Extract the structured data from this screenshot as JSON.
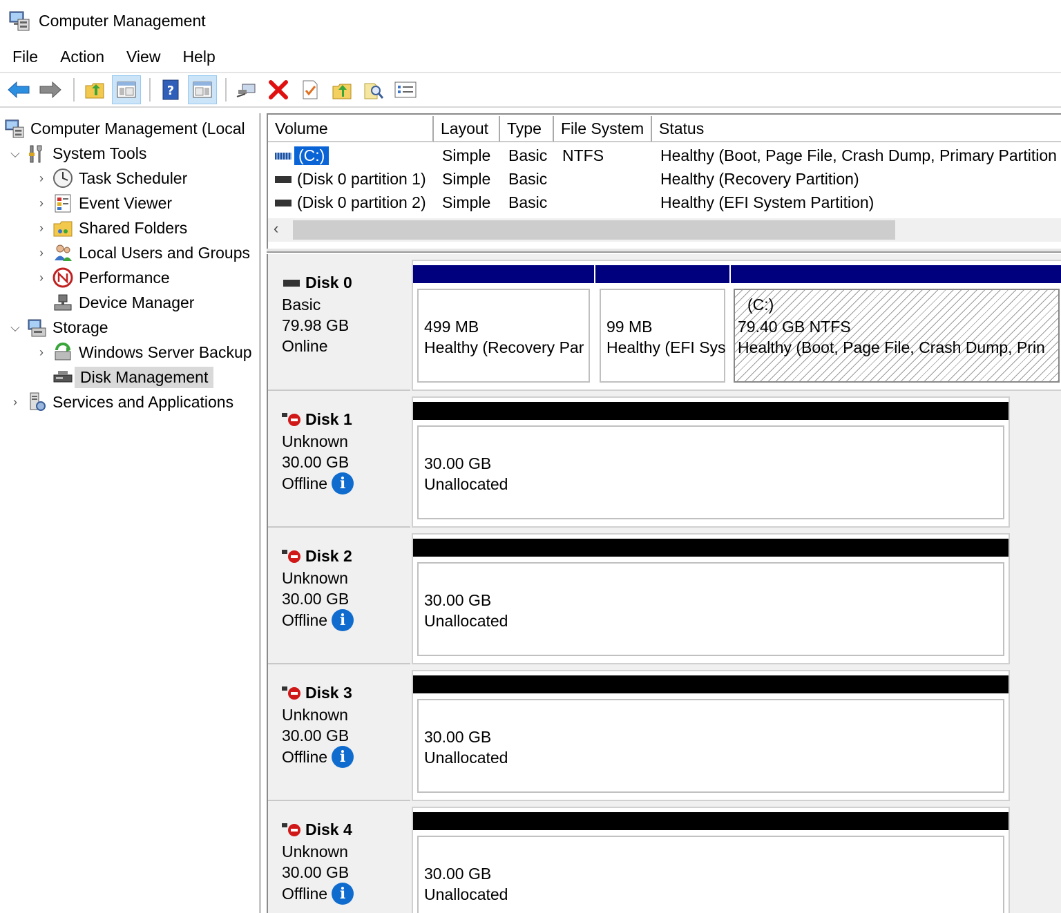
{
  "window": {
    "title": "Computer Management"
  },
  "menu": [
    "File",
    "Action",
    "View",
    "Help"
  ],
  "toolbar": [
    "back-arrow-icon",
    "forward-arrow-icon",
    "up-folder-icon",
    "show-hide-tree-icon",
    "help-icon",
    "show-hide-action-pane-icon",
    "connect-icon",
    "delete-icon",
    "properties-icon",
    "import-icon",
    "search-icon",
    "list-icon"
  ],
  "tree": {
    "root": "Computer Management (Local",
    "system_tools": "System Tools",
    "task_scheduler": "Task Scheduler",
    "event_viewer": "Event Viewer",
    "shared_folders": "Shared Folders",
    "local_users": "Local Users and Groups",
    "performance": "Performance",
    "device_manager": "Device Manager",
    "storage": "Storage",
    "wsb": "Windows Server Backup",
    "disk_management": "Disk Management",
    "services": "Services and Applications"
  },
  "volumes": {
    "columns": [
      "Volume",
      "Layout",
      "Type",
      "File System",
      "Status"
    ],
    "rows": [
      {
        "volume": "(C:)",
        "layout": "Simple",
        "type": "Basic",
        "fs": "NTFS",
        "status": "Healthy (Boot, Page File, Crash Dump, Primary Partition"
      },
      {
        "volume": "(Disk 0 partition 1)",
        "layout": "Simple",
        "type": "Basic",
        "fs": "",
        "status": "Healthy (Recovery Partition)"
      },
      {
        "volume": "(Disk 0 partition 2)",
        "layout": "Simple",
        "type": "Basic",
        "fs": "",
        "status": "Healthy (EFI System Partition)"
      }
    ]
  },
  "disks": [
    {
      "name": "Disk 0",
      "kind": "Basic",
      "size": "79.98 GB",
      "state": "Online",
      "partitions": [
        {
          "size": "499 MB",
          "desc": "Healthy (Recovery Par"
        },
        {
          "size": "99 MB",
          "desc": "Healthy (EFI Sys"
        },
        {
          "label": "(C:)",
          "size": "79.40 GB NTFS",
          "desc": "Healthy (Boot, Page File, Crash Dump, Prin"
        }
      ]
    },
    {
      "name": "Disk 1",
      "kind": "Unknown",
      "size": "30.00 GB",
      "state": "Offline",
      "partitions": [
        {
          "size": "30.00 GB",
          "desc": "Unallocated"
        }
      ]
    },
    {
      "name": "Disk 2",
      "kind": "Unknown",
      "size": "30.00 GB",
      "state": "Offline",
      "partitions": [
        {
          "size": "30.00 GB",
          "desc": "Unallocated"
        }
      ]
    },
    {
      "name": "Disk 3",
      "kind": "Unknown",
      "size": "30.00 GB",
      "state": "Offline",
      "partitions": [
        {
          "size": "30.00 GB",
          "desc": "Unallocated"
        }
      ]
    },
    {
      "name": "Disk 4",
      "kind": "Unknown",
      "size": "30.00 GB",
      "state": "Offline",
      "partitions": [
        {
          "size": "30.00 GB",
          "desc": "Unallocated"
        }
      ]
    }
  ],
  "colors": {
    "primary_partition": "#00007f",
    "unallocated": "#000000",
    "selection": "#0a64d6",
    "info": "#0f6cce"
  }
}
